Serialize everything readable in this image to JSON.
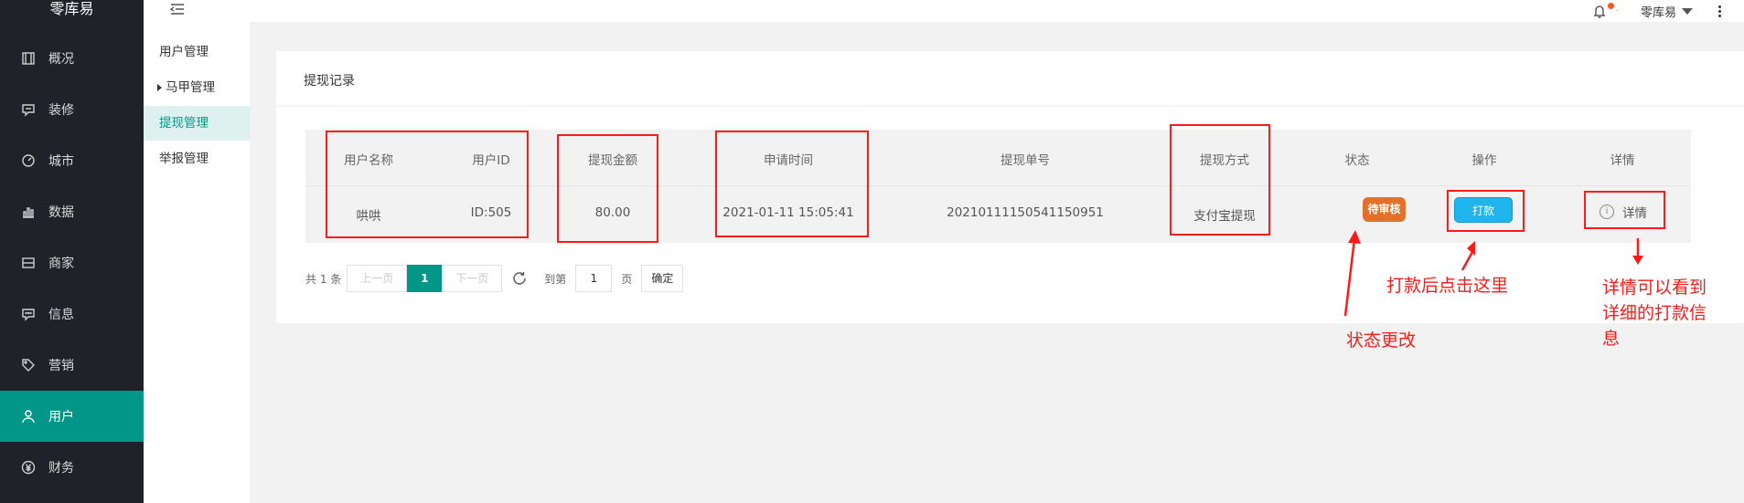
{
  "brand": "零库易",
  "header": {
    "user_name": "零库易",
    "bell_sep": "·"
  },
  "sidebar": {
    "items": [
      {
        "label": "概况",
        "icon": "frame-icon"
      },
      {
        "label": "装修",
        "icon": "message-icon"
      },
      {
        "label": "城市",
        "icon": "gauge-icon"
      },
      {
        "label": "数据",
        "icon": "bar-chart-icon"
      },
      {
        "label": "商家",
        "icon": "card-icon"
      },
      {
        "label": "信息",
        "icon": "chat-icon"
      },
      {
        "label": "营销",
        "icon": "tag-icon"
      },
      {
        "label": "用户",
        "icon": "user-icon",
        "active": true
      },
      {
        "label": "财务",
        "icon": "yen-icon"
      }
    ]
  },
  "submenu": {
    "items": [
      "用户管理",
      "马甲管理",
      "提现管理",
      "举报管理"
    ]
  },
  "card": {
    "title": "提现记录"
  },
  "table": {
    "headers": {
      "user_name": "用户名称",
      "user_id": "用户ID",
      "amount": "提现金额",
      "apply_time": "申请时间",
      "order_no": "提现单号",
      "method": "提现方式",
      "status": "状态",
      "action": "操作",
      "detail": "详情"
    },
    "row": {
      "user_name": "哄哄",
      "user_id": "ID:505",
      "amount": "80.00",
      "apply_time": "2021-01-11 15:05:41",
      "order_no": "20210111150541150951",
      "method": "支付宝提现",
      "status": "待审核",
      "action": "打款",
      "detail": "详情"
    }
  },
  "pager": {
    "total": "共 1 条",
    "prev": "上一页",
    "current": "1",
    "next": "下一页",
    "goto": "到第",
    "page_value": "1",
    "page_unit": "页",
    "confirm": "确定"
  },
  "annotations": {
    "status_change": "状态更改",
    "pay_click": "打款后点击这里",
    "detail_line1": "详情可以看到",
    "detail_line2": "详细的打款信",
    "detail_line3": "息"
  },
  "colors": {
    "accent": "#009688",
    "sidebar_bg": "#20222a",
    "annotation": "#ff1a1a",
    "pending": "#e5702a",
    "pay_button": "#1fb5ec"
  }
}
